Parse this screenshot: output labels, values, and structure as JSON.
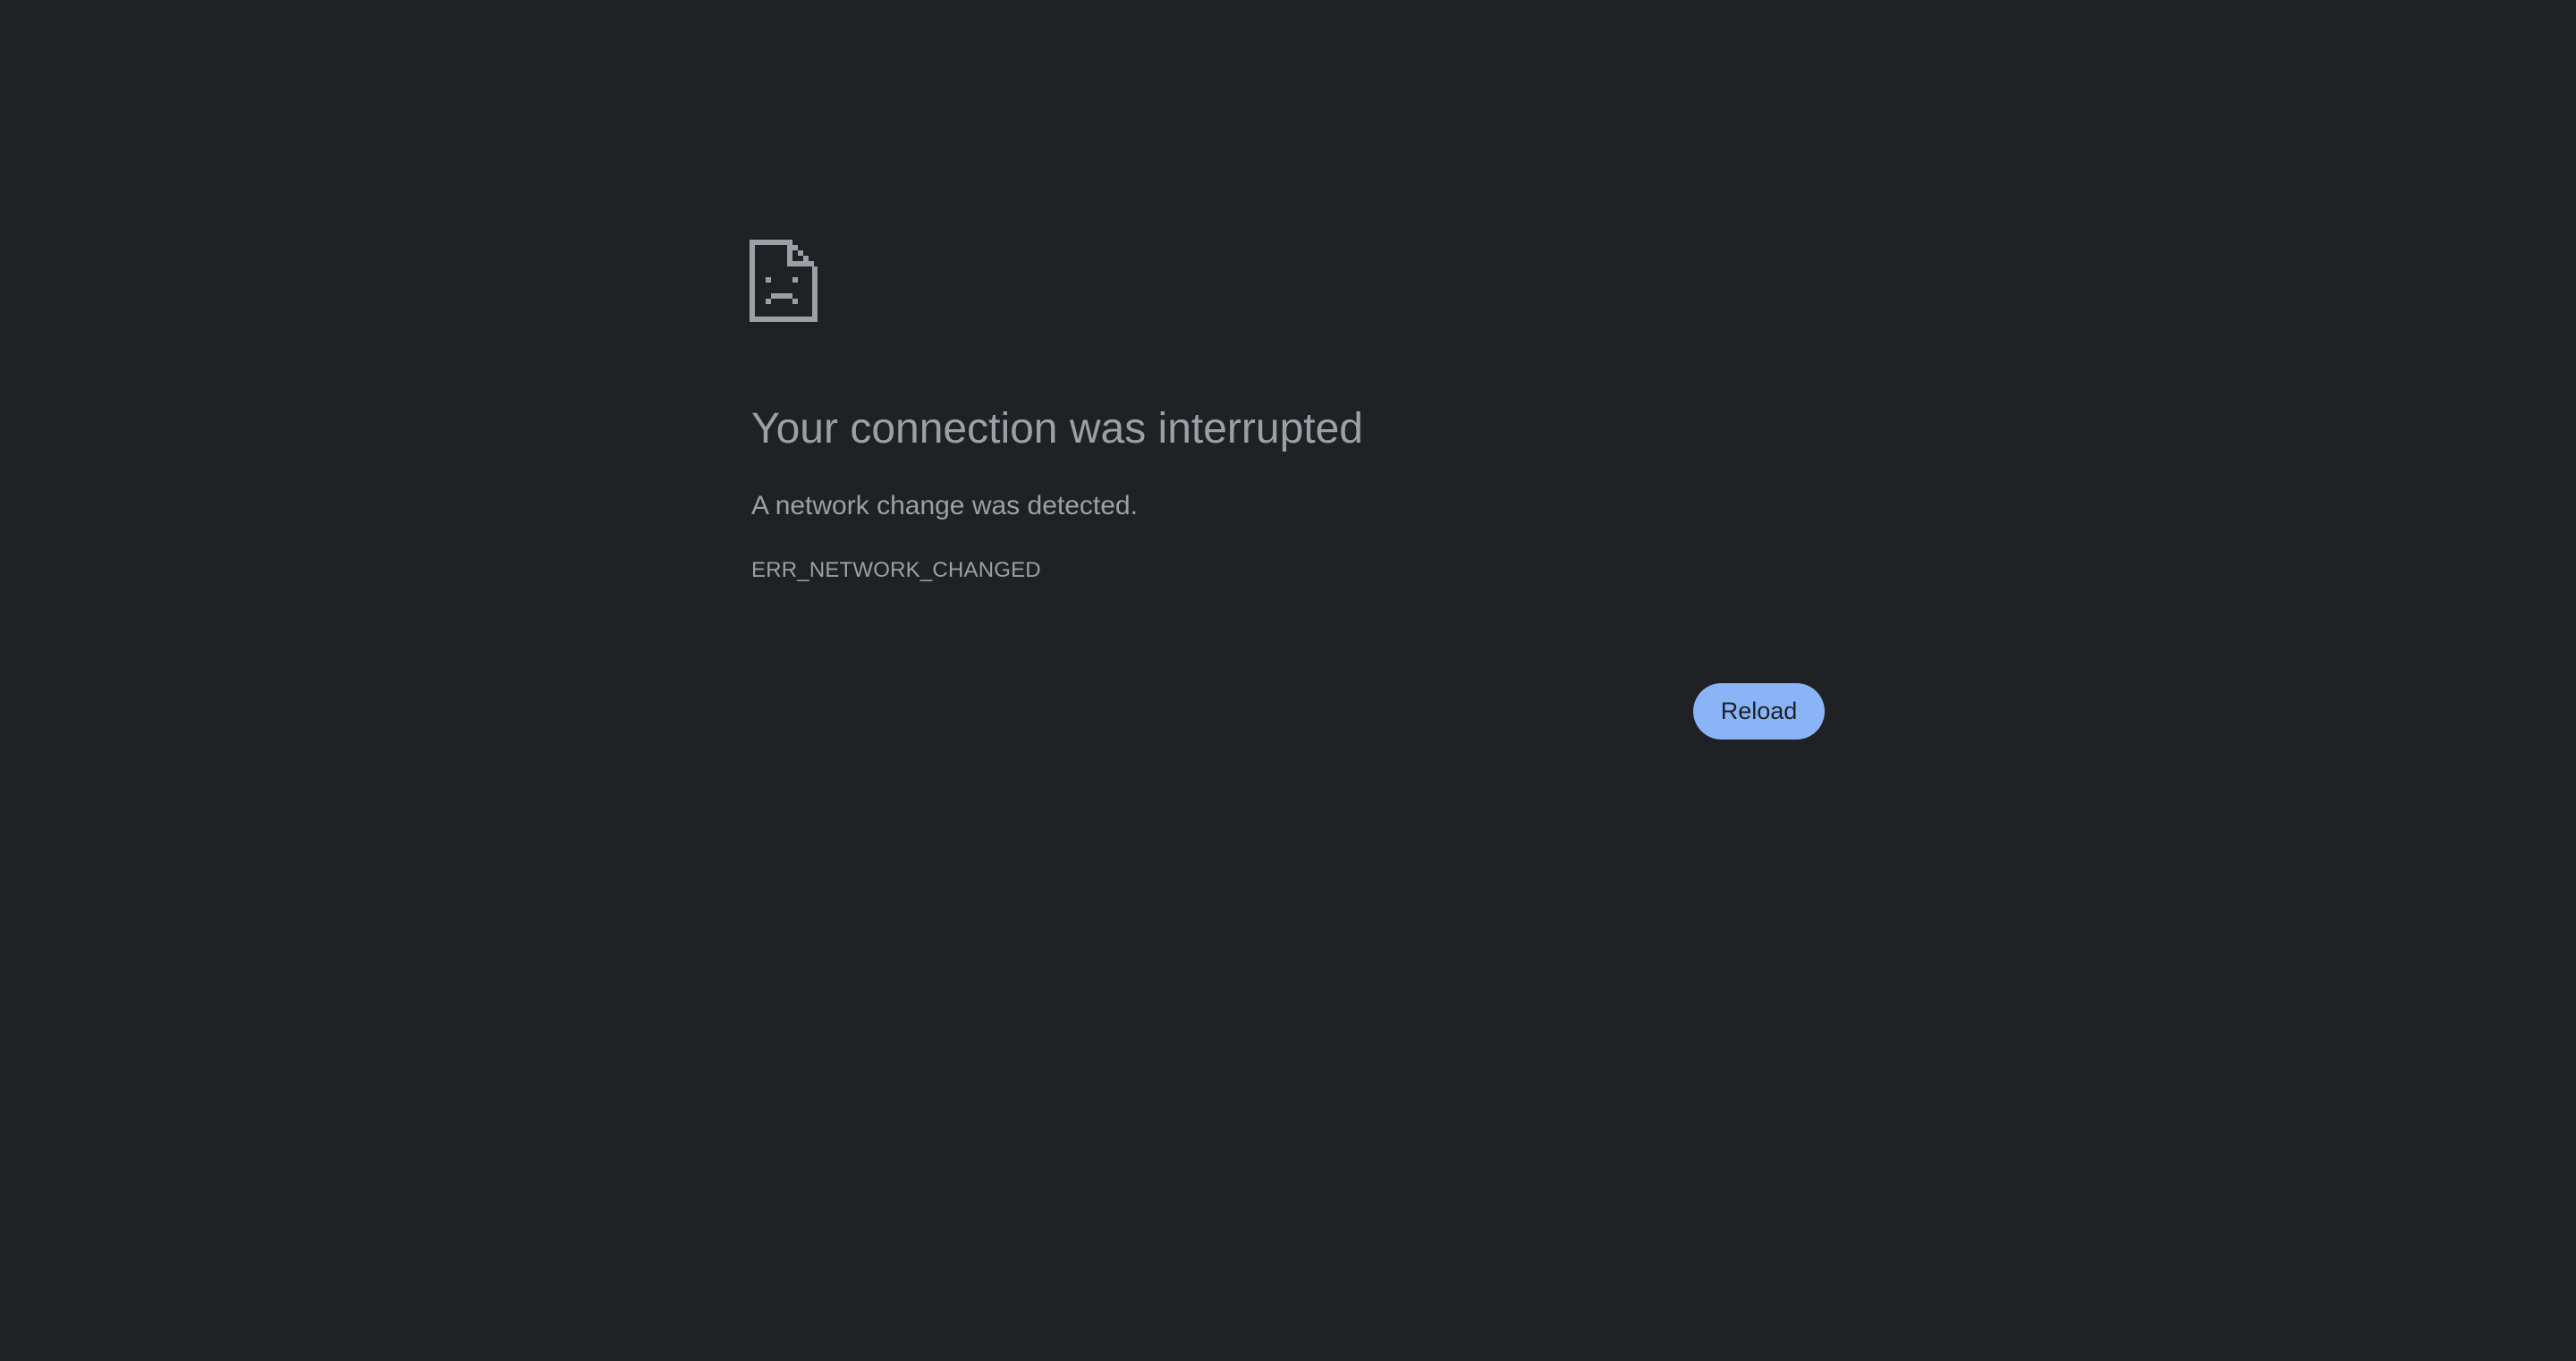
{
  "error_page": {
    "icon": "sad-document-icon",
    "title": "Your connection was interrupted",
    "summary": "A network change was detected.",
    "error_code": "ERR_NETWORK_CHANGED",
    "reload_label": "Reload"
  },
  "colors": {
    "background": "#202124",
    "text": "#9aa0a6",
    "button_bg": "#8ab4f8",
    "button_text": "#202124"
  }
}
